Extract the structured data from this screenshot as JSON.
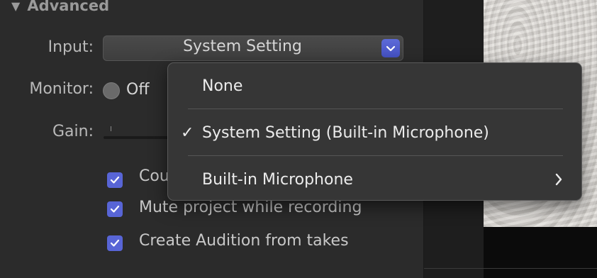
{
  "section": {
    "title": "Advanced"
  },
  "fields": {
    "input_label": "Input:",
    "input_value": "System Setting",
    "monitor_label": "Monitor:",
    "monitor_value": "Off",
    "gain_label": "Gain:"
  },
  "options": [
    {
      "label": "Cou",
      "checked": true
    },
    {
      "label": "Mute project while recording",
      "checked": true
    },
    {
      "label": "Create Audition from takes",
      "checked": true
    }
  ],
  "menu": {
    "items": [
      {
        "label": "None",
        "checked": false
      },
      {
        "label": "System Setting (Built-in Microphone)",
        "checked": true
      },
      {
        "label": "Built-in Microphone",
        "has_submenu": true
      }
    ],
    "check_glyph": "✓"
  },
  "colors": {
    "accent": "#5865d6",
    "menu_bg": "#363636"
  }
}
